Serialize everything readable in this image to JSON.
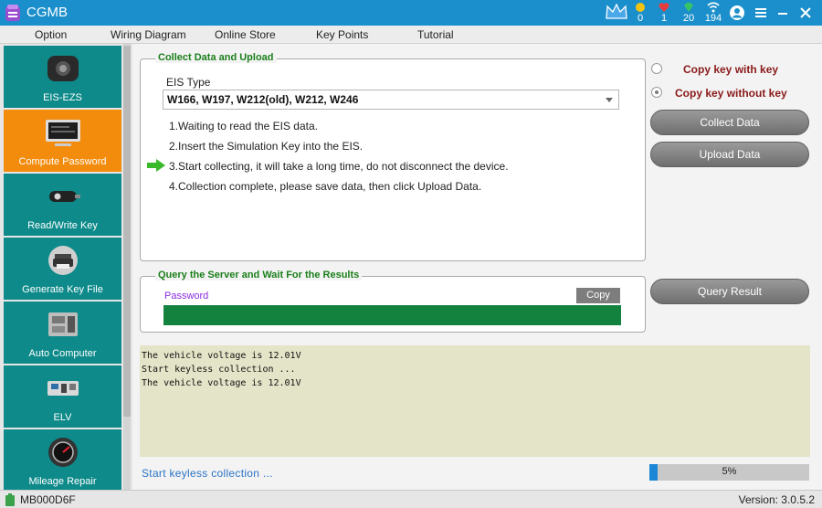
{
  "app": {
    "title": "CGMB"
  },
  "stats": {
    "coins": "0",
    "hearts": "1",
    "gems": "20",
    "wifi": "194"
  },
  "menu": [
    "Option",
    "Wiring Diagram",
    "Online Store",
    "Key Points",
    "Tutorial"
  ],
  "sidebar": {
    "items": [
      {
        "label": "EIS-EZS",
        "icon": "eis-module-icon"
      },
      {
        "label": "Compute Password",
        "icon": "computer-icon",
        "active": true
      },
      {
        "label": "Read/Write Key",
        "icon": "car-key-icon"
      },
      {
        "label": "Generate Key File",
        "icon": "printer-icon"
      },
      {
        "label": "Auto Computer",
        "icon": "ecu-icon"
      },
      {
        "label": "ELV",
        "icon": "elv-board-icon"
      },
      {
        "label": "Mileage Repair",
        "icon": "dashboard-gauge-icon"
      }
    ]
  },
  "collect": {
    "title": "Collect Data and Upload",
    "eis_type_label": "EIS Type",
    "eis_type_value": "W166,  W197,  W212(old),  W212,  W246",
    "steps": [
      "1.Waiting to read the EIS data.",
      "2.Insert the Simulation Key into the EIS.",
      "3.Start collecting, it will take a long time, do not disconnect the device.",
      "4.Collection complete, please save data, then click Upload Data."
    ],
    "current_step": 3
  },
  "options": {
    "copy_with_key": "Copy key with key",
    "copy_without_key": "Copy key without key",
    "selected": "copy_without_key"
  },
  "buttons": {
    "collect_data": "Collect Data",
    "upload_data": "Upload Data",
    "query_result": "Query Result",
    "copy": "Copy"
  },
  "query": {
    "title": "Query the Server and Wait For the Results",
    "password_label": "Password",
    "password_value": ""
  },
  "log": [
    "The vehicle voltage is 12.01V",
    "Start keyless collection ...",
    "The vehicle voltage is 12.01V"
  ],
  "status_message": "Start  keyless  collection  ...",
  "progress": {
    "percent": 5,
    "label": "5%"
  },
  "statusbar": {
    "device_id": "MB000D6F",
    "version": "Version: 3.0.5.2"
  },
  "colors": {
    "title_bar": "#1b8fcb",
    "sidebar_item": "#0e8a8a",
    "sidebar_active": "#f38b0c",
    "group_title": "#1b7f1b",
    "password_bar": "#13823f",
    "progress_fill": "#1c87d6"
  }
}
